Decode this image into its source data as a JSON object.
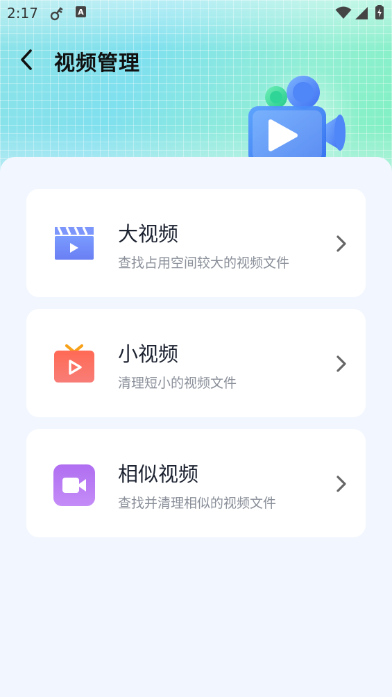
{
  "status_bar": {
    "time": "2:17"
  },
  "header": {
    "title": "视频管理"
  },
  "cards": [
    {
      "title": "大视频",
      "description": "查找占用空间较大的视频文件",
      "icon": "clapperboard-icon",
      "color": "#6b86f5"
    },
    {
      "title": "小视频",
      "description": "清理短小的视频文件",
      "icon": "tv-play-icon",
      "color": "#f4665e"
    },
    {
      "title": "相似视频",
      "description": "查找并清理相似的视频文件",
      "icon": "video-camera-icon",
      "color": "#b57af3"
    }
  ],
  "colors": {
    "background": "#f2f6fe",
    "header_gradient_start": "#8ee3e8",
    "header_gradient_end": "#7cf0be"
  }
}
